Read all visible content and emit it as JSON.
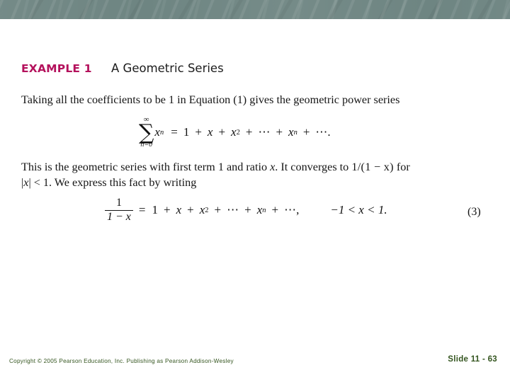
{
  "banner": {
    "color": "#6e8582"
  },
  "example": {
    "label": "EXAMPLE 1",
    "label_color": "#b4115c",
    "title": "A Geometric Series"
  },
  "paragraph_1": "Taking all the coefficients to be 1 in Equation (1) gives the geometric power series",
  "equation_sum": {
    "sigma": "∑",
    "upper_limit": "∞",
    "lower_limit": "n=0",
    "summand": "x",
    "summand_exponent": "n",
    "equals": "=",
    "term_1": "1",
    "plus": "+",
    "term_x": "x",
    "term_x2_base": "x",
    "term_x2_exp": "2",
    "ellipsis": "⋯",
    "term_xn_base": "x",
    "term_xn_exp": "n",
    "tail": "⋯",
    "period": "."
  },
  "paragraph_2": {
    "line_1_a": "This is the geometric series with first term 1 and ratio ",
    "line_1_var": "x",
    "line_1_b": ". It converges to ",
    "line_1_frac": "1/(1 − x)",
    "line_1_c": " for",
    "line_2_a": "|",
    "line_2_var": "x",
    "line_2_b": "| < 1. We express this fact by writing"
  },
  "equation_three": {
    "fraction_numerator": "1",
    "fraction_denominator": "1 − x",
    "equals": "=",
    "term_1": "1",
    "plus": "+",
    "term_x": "x",
    "term_x2_base": "x",
    "term_x2_exp": "2",
    "ellipsis": "⋯",
    "term_xn_base": "x",
    "term_xn_exp": "n",
    "tail": "⋯,",
    "condition": "−1 < x < 1.",
    "number": "(3)"
  },
  "footer": {
    "copyright": "Copyright © 2005 Pearson Education, Inc.  Publishing as Pearson Addison-Wesley",
    "slide_number": "Slide 11 - 63",
    "text_color": "#34551f"
  }
}
